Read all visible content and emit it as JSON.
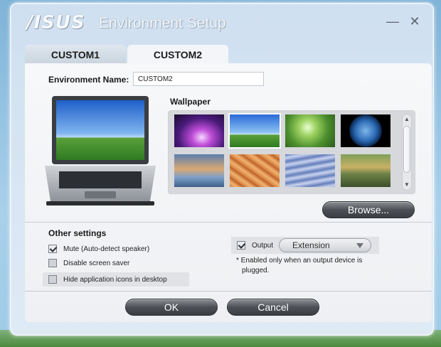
{
  "window": {
    "logo": "/ISUS",
    "title": "Environment Setup",
    "minimize_glyph": "—",
    "close_glyph": "✕"
  },
  "tabs": [
    {
      "label": "CUSTOM1",
      "active": false
    },
    {
      "label": "CUSTOM2",
      "active": true
    }
  ],
  "environment": {
    "name_label": "Environment Name:",
    "name_value": "CUSTOM2"
  },
  "wallpaper": {
    "label": "Wallpaper",
    "thumbnails": [
      {
        "name": "purple-aurora",
        "selected": false
      },
      {
        "name": "green-field-blue-sky",
        "selected": true
      },
      {
        "name": "green-leaf-droplet",
        "selected": false
      },
      {
        "name": "earth-globe",
        "selected": false
      },
      {
        "name": "blue-orange-abstract",
        "selected": false
      },
      {
        "name": "desert-sandstone",
        "selected": false
      },
      {
        "name": "blue-waves",
        "selected": false
      },
      {
        "name": "japanese-temple",
        "selected": false
      }
    ],
    "browse_label": "Browse..."
  },
  "other_settings": {
    "label": "Other settings",
    "options": [
      {
        "label": "Mute (Auto-detect speaker)",
        "checked": true
      },
      {
        "label": "Disable screen saver",
        "checked": false
      },
      {
        "label": "Hide application icons in desktop",
        "checked": false
      }
    ],
    "output": {
      "label": "Output",
      "checked": true,
      "selected": "Extension"
    },
    "note_line1": "* Enabled only when an output device is",
    "note_line2": "plugged."
  },
  "buttons": {
    "ok": "OK",
    "cancel": "Cancel"
  },
  "colors": {
    "dark_button": "#4d5156",
    "accent_green": "#4caf50",
    "sky_blue": "#3a7bd5"
  }
}
